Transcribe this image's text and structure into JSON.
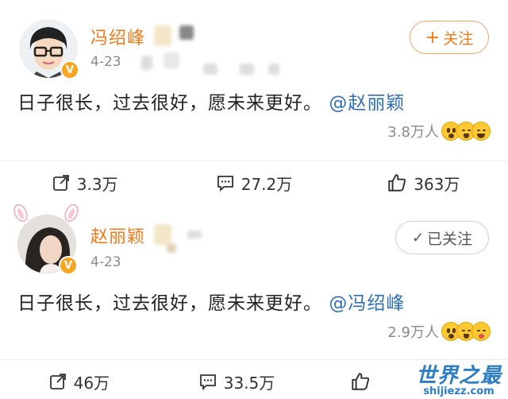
{
  "posts": [
    {
      "username": "冯绍峰",
      "date": "4-23",
      "follow_label": "关注",
      "follow_prefix": "+",
      "content_text": "日子很长，过去很好，愿未来更好。",
      "mention": "@赵丽颖",
      "reaction_count": "3.8万人",
      "actions": {
        "repost": "3.3万",
        "comment": "27.2万",
        "like": "363万"
      }
    },
    {
      "username": "赵丽颖",
      "date": "4-23",
      "follow_label": "已关注",
      "follow_prefix": "✓",
      "content_text": "日子很长，过去很好，愿未来更好。",
      "mention": "@冯绍峰",
      "reaction_count": "2.9万人",
      "actions": {
        "repost": "46万",
        "comment": "33.5万",
        "like": ""
      }
    }
  ],
  "watermark": {
    "main": "世界之最",
    "sub": "shijiezz.com"
  },
  "colors": {
    "username": "#f07a17",
    "mention": "#2f6fb6",
    "verified": "#f5a623",
    "watermark": "#2b7dc6"
  },
  "icons": [
    "repost-icon",
    "comment-icon",
    "like-icon",
    "verified-badge-icon",
    "plus-icon",
    "check-icon",
    "emoji-icon"
  ]
}
